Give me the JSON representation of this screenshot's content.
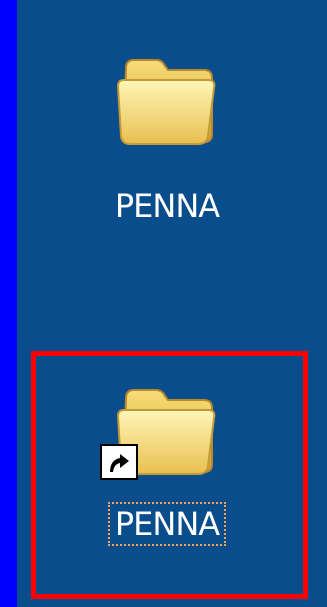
{
  "desktop": {
    "icons": [
      {
        "label": "PENNA",
        "type": "folder",
        "icon": "folder-icon"
      },
      {
        "label": "PENNA",
        "type": "folder-shortcut",
        "icon": "folder-icon",
        "overlay_icon": "shortcut-arrow-icon",
        "selected": true
      }
    ]
  },
  "colors": {
    "desktop_background": "#0a4d8c",
    "frame": "#0000ff",
    "highlight_box": "#ff0000",
    "focus_outline": "#f5a35a",
    "label_text": "#ffffff"
  }
}
